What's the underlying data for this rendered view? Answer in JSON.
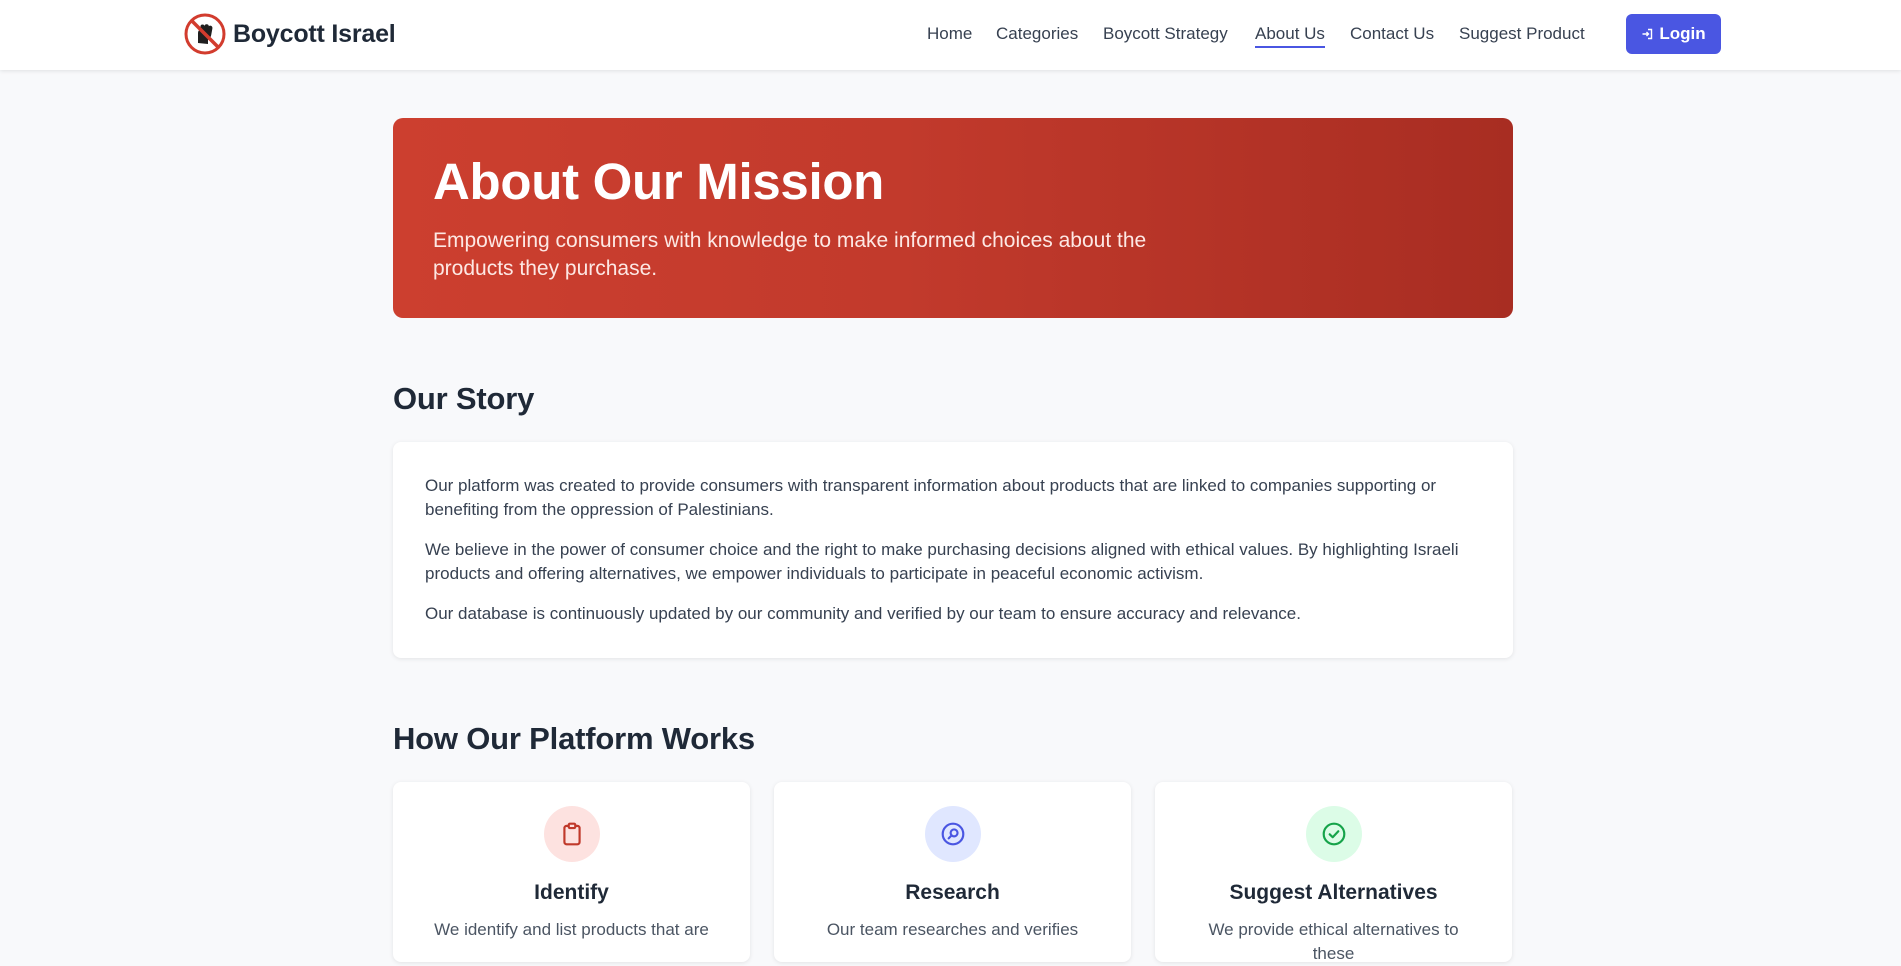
{
  "header": {
    "brand_name": "Boycott Israel",
    "nav": [
      {
        "label": "Home",
        "active": false
      },
      {
        "label": "Categories",
        "active": false
      },
      {
        "label": "Boycott Strategy",
        "active": false
      },
      {
        "label": "About Us",
        "active": true
      },
      {
        "label": "Contact Us",
        "active": false
      },
      {
        "label": "Suggest Product",
        "active": false
      }
    ],
    "login_label": "Login"
  },
  "hero": {
    "title": "About Our Mission",
    "subtitle": "Empowering consumers with knowledge to make informed choices about the products they purchase."
  },
  "story": {
    "title": "Our Story",
    "paragraphs": [
      "Our platform was created to provide consumers with transparent information about products that are linked to companies supporting or benefiting from the oppression of Palestinians.",
      "We believe in the power of consumer choice and the right to make purchasing decisions aligned with ethical values. By highlighting Israeli products and offering alternatives, we empower individuals to participate in peaceful economic activism.",
      "Our database is continuously updated by our community and verified by our team to ensure accuracy and relevance."
    ]
  },
  "how": {
    "title": "How Our Platform Works",
    "features": [
      {
        "title": "Identify",
        "description": "We identify and list products that are",
        "icon": "clipboard-icon",
        "color": "#c0392b",
        "bg": "#fde2e0"
      },
      {
        "title": "Research",
        "description": "Our team researches and verifies",
        "icon": "search-icon",
        "color": "#4a56e2",
        "bg": "#e0e7ff"
      },
      {
        "title": "Suggest Alternatives",
        "description": "We provide ethical alternatives to these",
        "icon": "check-circle-icon",
        "color": "#16a34a",
        "bg": "#dcfce7"
      }
    ]
  },
  "colors": {
    "accent": "#4a56e2",
    "hero": "#c23a2c"
  }
}
